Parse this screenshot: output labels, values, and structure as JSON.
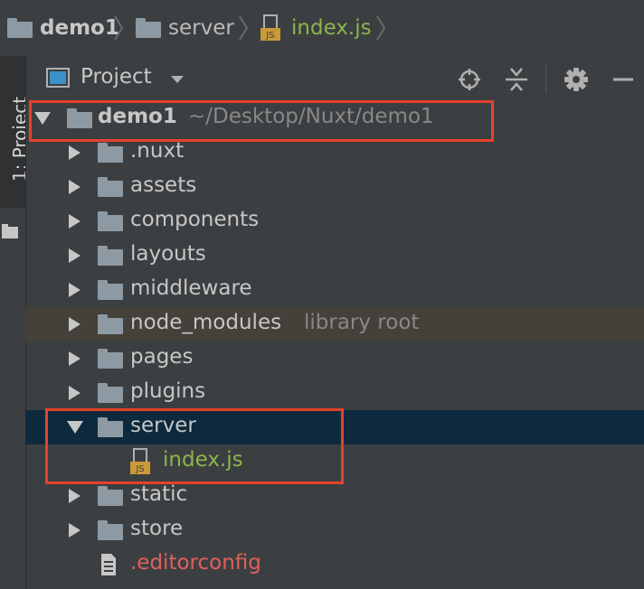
{
  "breadcrumb": [
    {
      "label": "demo1",
      "type": "folder"
    },
    {
      "label": "server",
      "type": "folder"
    },
    {
      "label": "index.js",
      "type": "js-file"
    }
  ],
  "tool_window": {
    "stripe_number": "1",
    "stripe_label": ": Project"
  },
  "toolbar": {
    "view_label": "Project",
    "icons": [
      "locate-icon",
      "collapse-all-icon",
      "gear-icon",
      "minimize-icon"
    ]
  },
  "tree": {
    "root": {
      "name": "demo1",
      "path": "~/Desktop/Nuxt/demo1"
    },
    "items": [
      {
        "name": ".nuxt"
      },
      {
        "name": "assets"
      },
      {
        "name": "components"
      },
      {
        "name": "layouts"
      },
      {
        "name": "middleware"
      },
      {
        "name": "node_modules",
        "hint": "library root"
      },
      {
        "name": "pages"
      },
      {
        "name": "plugins"
      },
      {
        "name": "server"
      },
      {
        "name": "index.js"
      },
      {
        "name": "static"
      },
      {
        "name": "store"
      },
      {
        "name": ".editorconfig"
      }
    ]
  },
  "colors": {
    "background": "#3c3f41",
    "selected_row": "#0d293e",
    "library_row": "#44403a",
    "js_file_text": "#8cb54a",
    "untracked_text": "#e0605a",
    "highlight_box": "#e5422d"
  }
}
